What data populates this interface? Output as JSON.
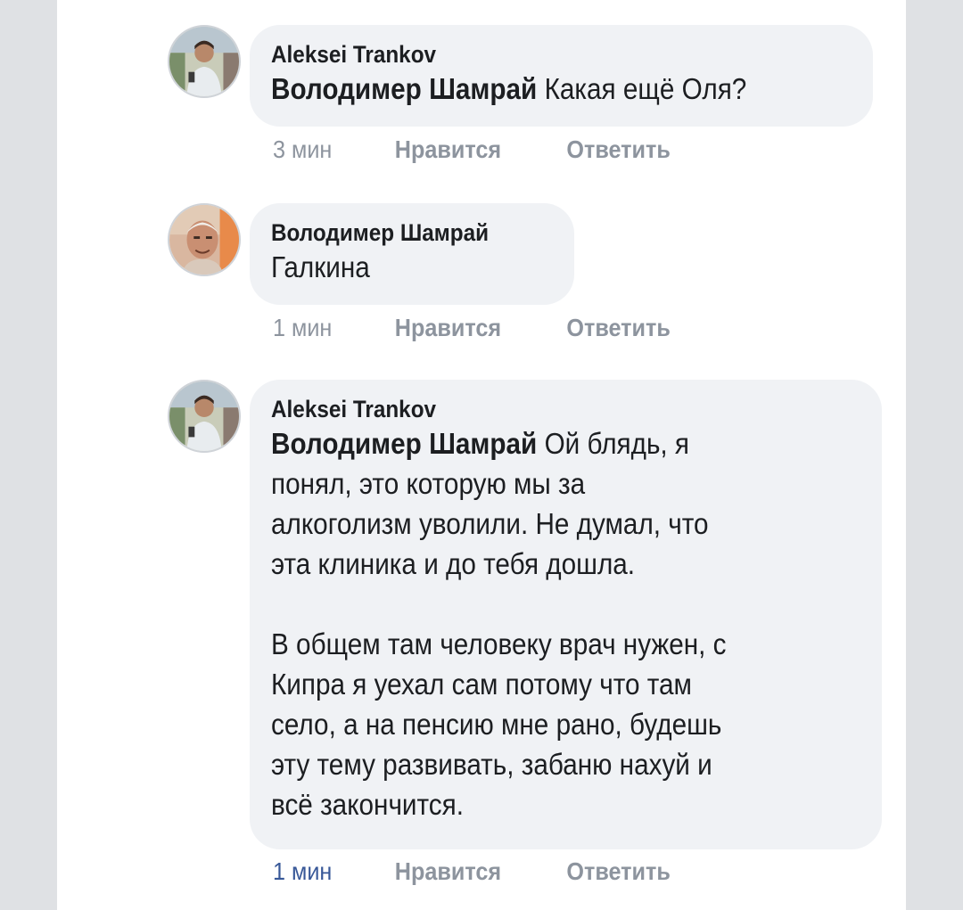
{
  "colors": {
    "bubble": "#f0f2f5",
    "meta": "#8d949e",
    "link": "#385898",
    "text": "#1c1e21"
  },
  "comments": [
    {
      "author": "Aleksei Trankov",
      "mention": "Володимер Шамрай",
      "text": "Какая ещё Оля?",
      "time": "3 мин",
      "like": "Нравится",
      "reply": "Ответить"
    },
    {
      "author": "Володимер Шамрай",
      "text": "Галкина",
      "time": "1 мин",
      "like": "Нравится",
      "reply": "Ответить"
    },
    {
      "author": "Aleksei Trankov",
      "mention": "Володимер Шамрай",
      "lines_p1": [
        "Ой блядь, я",
        "понял, это которую мы за",
        "алкоголизм уволили. Не думал, что",
        "эта клиника и до тебя дошла."
      ],
      "lines_p2": [
        "В общем там человеку врач нужен, с",
        "Кипра я уехал сам потому что там",
        "село, а на пенсию мне рано, будешь",
        "эту тему развивать, забаню нахуй и",
        "всё закончится."
      ],
      "time": "1 мин",
      "like": "Нравится",
      "reply": "Ответить"
    }
  ]
}
